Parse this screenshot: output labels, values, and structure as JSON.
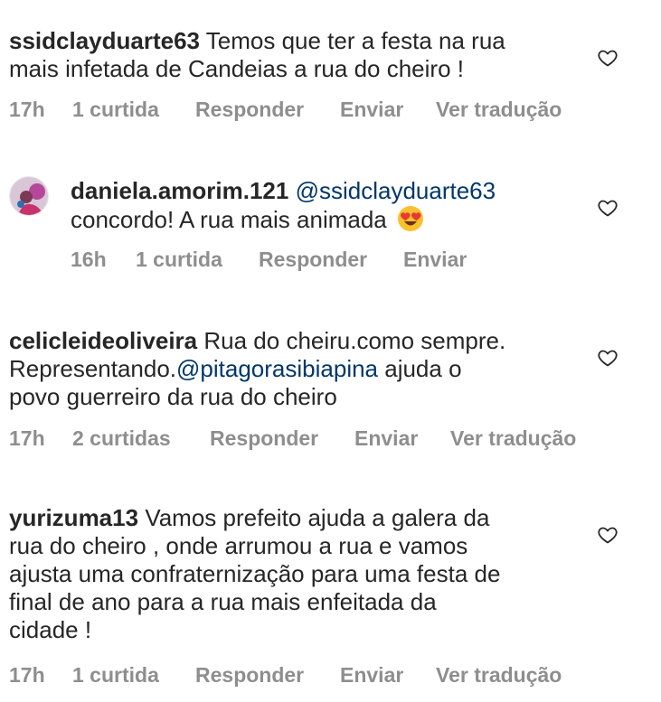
{
  "comments": [
    {
      "username": "ssidclayduarte63",
      "text_line1": "Temos que ter a festa na rua",
      "text_line2": "mais infetada de Candeias a rua do cheiro !",
      "time": "17h",
      "likes": "1 curtida",
      "reply": "Responder",
      "send": "Enviar",
      "translate": "Ver tradução"
    },
    {
      "username": "daniela.amorim.121",
      "mention": "@ssidclayduarte63",
      "text_line2": "concordo!  A rua mais animada",
      "emoji": "heart-eyes-emoji",
      "time": "16h",
      "likes": "1 curtida",
      "reply": "Responder",
      "send": "Enviar"
    },
    {
      "username": "celicleideoliveira",
      "text_line1": "Rua do cheiru.como sempre.",
      "text_line2a": "Representando.",
      "mention": "@pitagorasibiapina",
      "text_line2b": " ajuda o",
      "text_line3": "povo guerreiro da rua do cheiro",
      "time": "17h",
      "likes": "2 curtidas",
      "reply": "Responder",
      "send": "Enviar",
      "translate": "Ver tradução"
    },
    {
      "username": "yurizuma13",
      "text_line1": "Vamos prefeito ajuda a galera da",
      "text_line2": "rua do cheiro , onde arrumou a rua e vamos",
      "text_line3": "ajusta uma confraternização para uma festa de",
      "text_line4": "final de ano para a rua mais enfeitada da",
      "text_line5": "cidade !",
      "time": "17h",
      "likes": "1 curtida",
      "reply": "Responder",
      "send": "Enviar",
      "translate": "Ver tradução"
    }
  ],
  "colors": {
    "text": "#262626",
    "meta": "#8e8e8e",
    "mention": "#00376b"
  },
  "icons": {
    "like": "heart-outline-icon"
  }
}
